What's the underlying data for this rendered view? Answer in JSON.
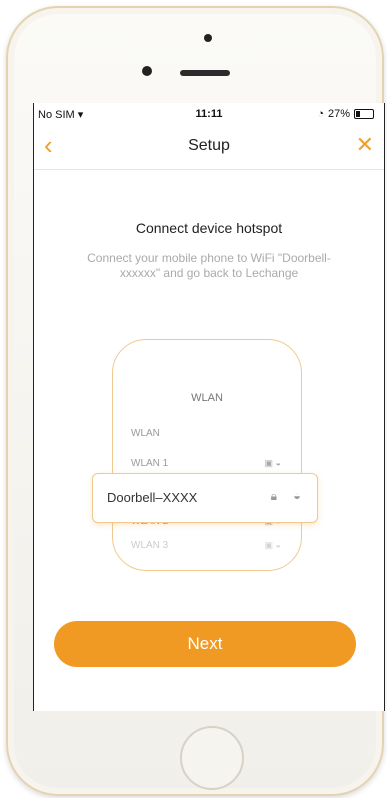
{
  "status": {
    "carrier": "No SIM",
    "time": "11:11",
    "battery": "27%",
    "battery_level": 0.27
  },
  "nav": {
    "title": "Setup",
    "back_icon": "chevron-left-icon",
    "close_icon": "close-icon"
  },
  "content": {
    "title": "Connect device hotspot",
    "description": "Connect your mobile phone to WiFi \"Doorbell-xxxxxx\" and go back to Lechange"
  },
  "illustration": {
    "header": "WLAN",
    "rows": [
      "WLAN",
      "WLAN 1",
      "WLAN 2",
      "WLAN 3"
    ],
    "highlighted": "Doorbell–XXXX"
  },
  "actions": {
    "next_label": "Next"
  },
  "colors": {
    "accent": "#f09a24"
  }
}
